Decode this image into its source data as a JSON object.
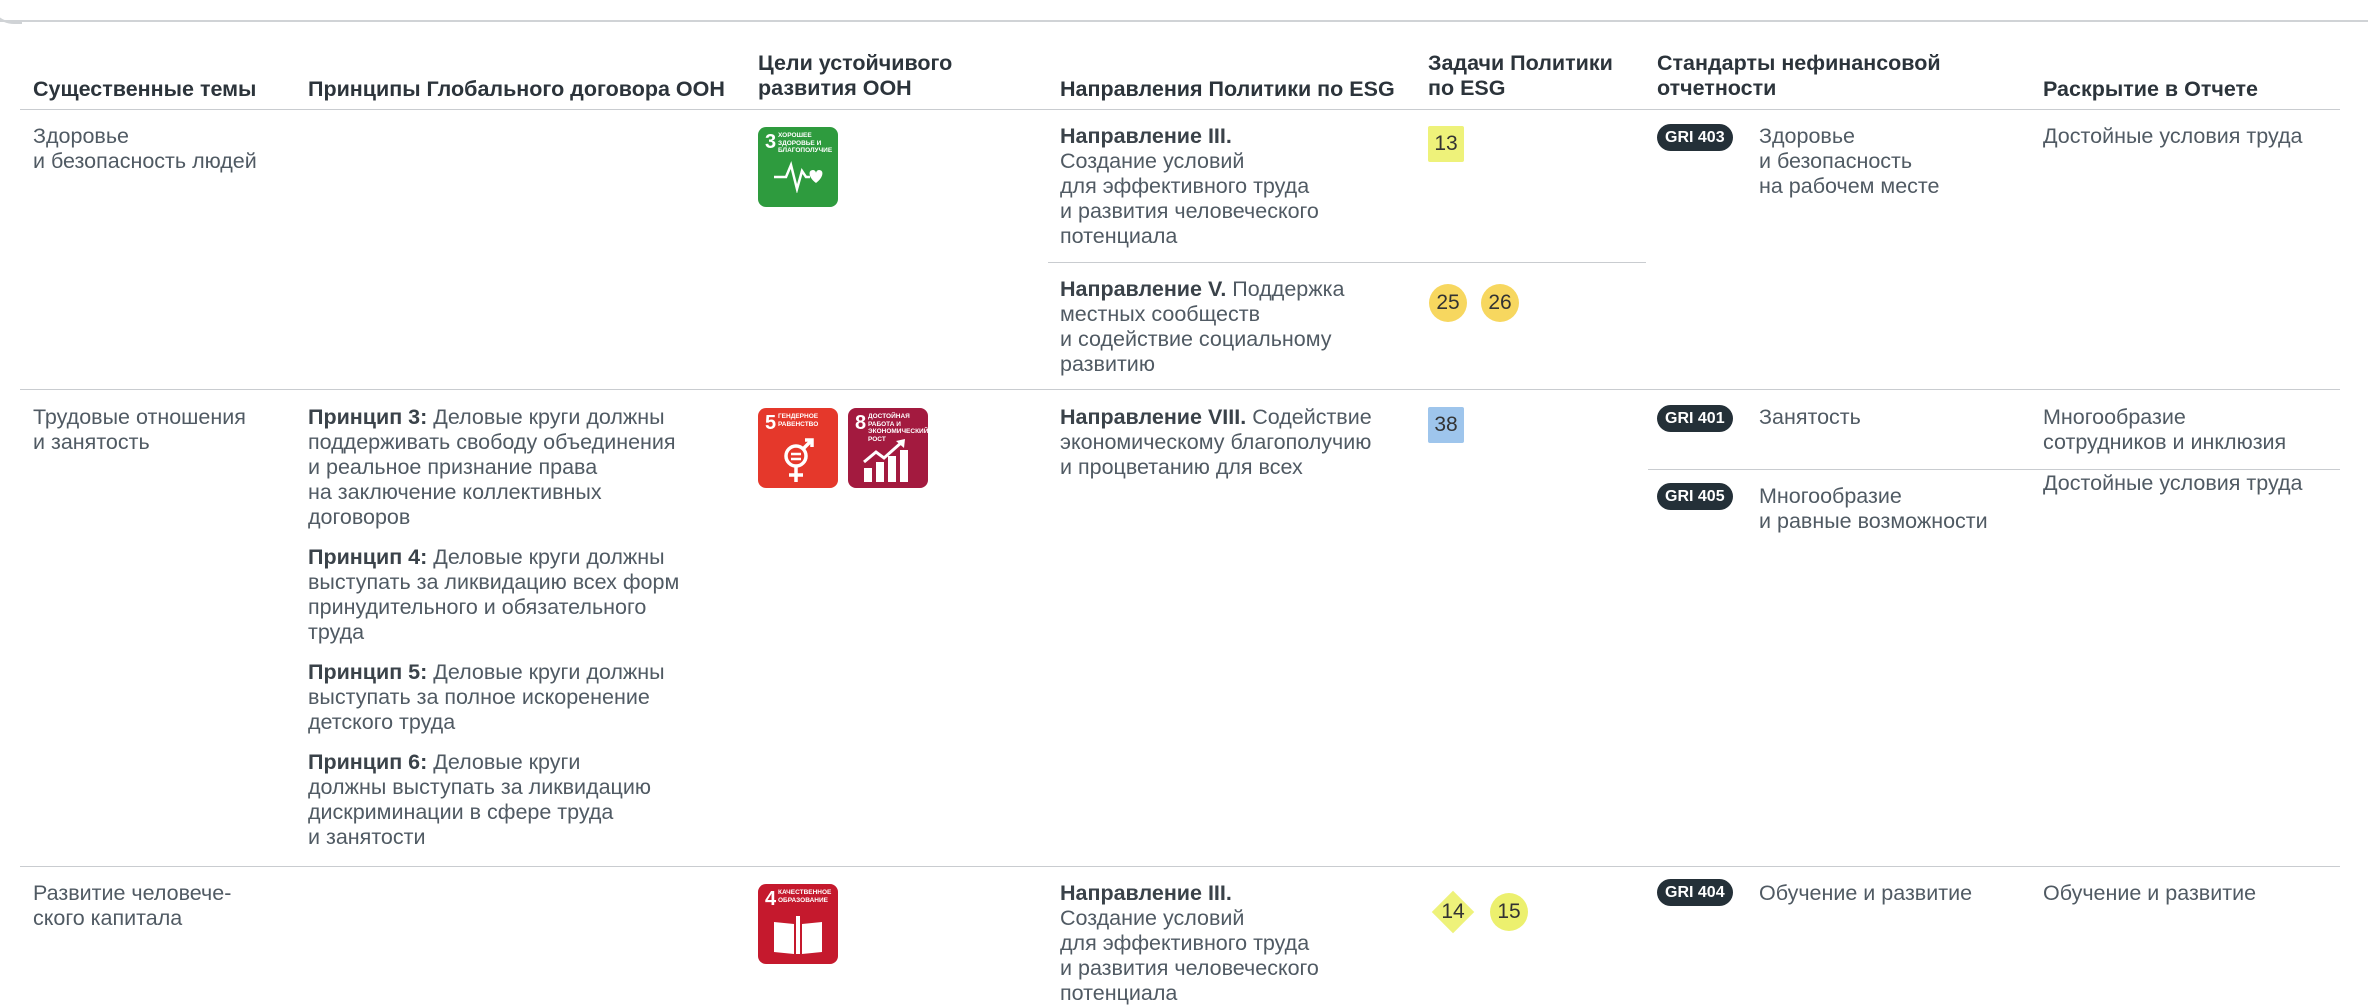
{
  "headers": {
    "topics": "Существенные темы",
    "un_gc": "Принципы Глобального договора ООН",
    "sdg": "Цели устойчивого развития ООН",
    "esg_directions": "Направления Политики по ESG",
    "esg_tasks": "Задачи Политики по ESG",
    "standards": "Стандарты нефинансовой отчетности",
    "disclosure": "Раскрытие в Отчете"
  },
  "row1": {
    "topic": "Здоровье\nи безопасность людей",
    "sdg": [
      {
        "num": "3",
        "title": "Хорошее здоровье и благополучие",
        "color": "#2e9b3e",
        "icon": "heartbeat-icon"
      }
    ],
    "directions": [
      {
        "bold": "Направление III.",
        "text": "Создание условий\nдля эффективного труда\nи развития человеческого\nпотенциала"
      },
      {
        "bold": "Направление V.",
        "text": "Поддержка\nместных сообществ\nи содействие социальному\nразвитию"
      }
    ],
    "tasks_a": [
      "13"
    ],
    "tasks_b": [
      "25",
      "26"
    ],
    "standards": [
      {
        "code": "GRI 403",
        "text": "Здоровье\nи безопасность\nна рабочем месте"
      }
    ],
    "disclosure": [
      "Достойные условия труда"
    ]
  },
  "row2": {
    "topic": "Трудовые отношения\nи занятость",
    "principles": [
      {
        "bold": "Принцип 3:",
        "text": "Деловые круги должны\nподдерживать свободу объединения\nи реальное признание права\nна заключение коллективных\nдоговоров"
      },
      {
        "bold": "Принцип 4:",
        "text": "Деловые круги должны\nвыступать за ликвидацию всех форм\nпринудительного и обязательного\nтруда"
      },
      {
        "bold": "Принцип 5:",
        "text": "Деловые круги должны\nвыступать за полное искоренение\nдетского труда"
      },
      {
        "bold": "Принцип 6:",
        "text": "Деловые круги\nдолжны выступать за ликвидацию\nдискриминации в сфере труда\nи занятости"
      }
    ],
    "sdg": [
      {
        "num": "5",
        "title": "Гендерное равенство",
        "color": "#e5382b",
        "icon": "gender-equality-icon"
      },
      {
        "num": "8",
        "title": "Достойная работа и экономический рост",
        "color": "#a31a3f",
        "icon": "growth-chart-icon"
      }
    ],
    "directions": [
      {
        "bold": "Направление VIII.",
        "text": "Содействие\nэкономическому благополучию\nи процветанию для всех"
      }
    ],
    "tasks": [
      "38"
    ],
    "standards": [
      {
        "code": "GRI 401",
        "text": "Занятость"
      },
      {
        "code": "GRI 405",
        "text": "Многообразие\nи равные возможности"
      }
    ],
    "disclosure": [
      "Многообразие\nсотрудников и инклюзия",
      "Достойные условия труда"
    ]
  },
  "row3": {
    "topic": "Развитие человече-\nского капитала",
    "sdg": [
      {
        "num": "4",
        "title": "Качественное образование",
        "color": "#c5192d",
        "icon": "book-icon"
      }
    ],
    "directions": [
      {
        "bold": "Направление III.",
        "text": "Создание условий\nдля эффективного труда\nи развития человеческого\nпотенциала"
      }
    ],
    "tasks": [
      "14",
      "15"
    ],
    "standards": [
      {
        "code": "GRI 404",
        "text": "Обучение и развитие"
      }
    ],
    "disclosure": [
      "Обучение и развитие"
    ]
  }
}
